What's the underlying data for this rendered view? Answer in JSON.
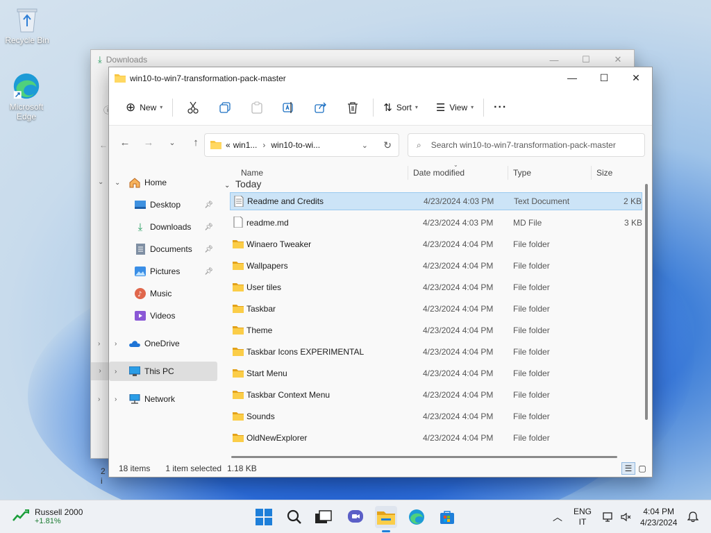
{
  "desktop": {
    "icons": [
      {
        "label": "Recycle Bin",
        "icon": "recycle-bin-icon"
      },
      {
        "label": "Microsoft Edge",
        "icon": "edge-icon"
      }
    ]
  },
  "back_window": {
    "title": "Downloads",
    "items_count_fragment": "2 i"
  },
  "window": {
    "title": "win10-to-win7-transformation-pack-master",
    "toolbar": {
      "new_label": "New",
      "sort_label": "Sort",
      "view_label": "View",
      "more_label": "···"
    },
    "address": {
      "prefix": "«",
      "segment1": "win1...",
      "segment2": "win10-to-wi..."
    },
    "search": {
      "placeholder": "Search win10-to-win7-transformation-pack-master"
    },
    "sidebar": {
      "home": "Home",
      "quick": [
        "Desktop",
        "Downloads",
        "Documents",
        "Pictures",
        "Music",
        "Videos"
      ],
      "onedrive": "OneDrive",
      "thispc": "This PC",
      "network": "Network"
    },
    "columns": {
      "name": "Name",
      "date": "Date modified",
      "type": "Type",
      "size": "Size"
    },
    "group_label": "Today",
    "files": [
      {
        "name": "Readme and Credits",
        "date": "4/23/2024 4:03 PM",
        "type": "Text Document",
        "size": "2 KB",
        "kind": "doc",
        "selected": true
      },
      {
        "name": "readme.md",
        "date": "4/23/2024 4:03 PM",
        "type": "MD File",
        "size": "3 KB",
        "kind": "file",
        "selected": false
      },
      {
        "name": "Winaero Tweaker",
        "date": "4/23/2024 4:04 PM",
        "type": "File folder",
        "size": "",
        "kind": "folder",
        "selected": false
      },
      {
        "name": "Wallpapers",
        "date": "4/23/2024 4:04 PM",
        "type": "File folder",
        "size": "",
        "kind": "folder",
        "selected": false
      },
      {
        "name": "User tiles",
        "date": "4/23/2024 4:04 PM",
        "type": "File folder",
        "size": "",
        "kind": "folder",
        "selected": false
      },
      {
        "name": "Taskbar",
        "date": "4/23/2024 4:04 PM",
        "type": "File folder",
        "size": "",
        "kind": "folder",
        "selected": false
      },
      {
        "name": "Theme",
        "date": "4/23/2024 4:04 PM",
        "type": "File folder",
        "size": "",
        "kind": "folder",
        "selected": false
      },
      {
        "name": "Taskbar Icons EXPERIMENTAL",
        "date": "4/23/2024 4:04 PM",
        "type": "File folder",
        "size": "",
        "kind": "folder",
        "selected": false
      },
      {
        "name": "Start Menu",
        "date": "4/23/2024 4:04 PM",
        "type": "File folder",
        "size": "",
        "kind": "folder",
        "selected": false
      },
      {
        "name": "Taskbar Context Menu",
        "date": "4/23/2024 4:04 PM",
        "type": "File folder",
        "size": "",
        "kind": "folder",
        "selected": false
      },
      {
        "name": "Sounds",
        "date": "4/23/2024 4:04 PM",
        "type": "File folder",
        "size": "",
        "kind": "folder",
        "selected": false
      },
      {
        "name": "OldNewExplorer",
        "date": "4/23/2024 4:04 PM",
        "type": "File folder",
        "size": "",
        "kind": "folder",
        "selected": false
      }
    ],
    "status": {
      "items": "18 items",
      "selected": "1 item selected",
      "size": "1.18 KB"
    }
  },
  "taskbar": {
    "widget": {
      "name": "Russell 2000",
      "change": "+1.81%"
    },
    "lang_top": "ENG",
    "lang_bottom": "IT",
    "time": "4:04 PM",
    "date": "4/23/2024"
  },
  "colors": {
    "accent": "#0078d4",
    "folder": "#f8c643",
    "selection": "#cce4f7"
  }
}
